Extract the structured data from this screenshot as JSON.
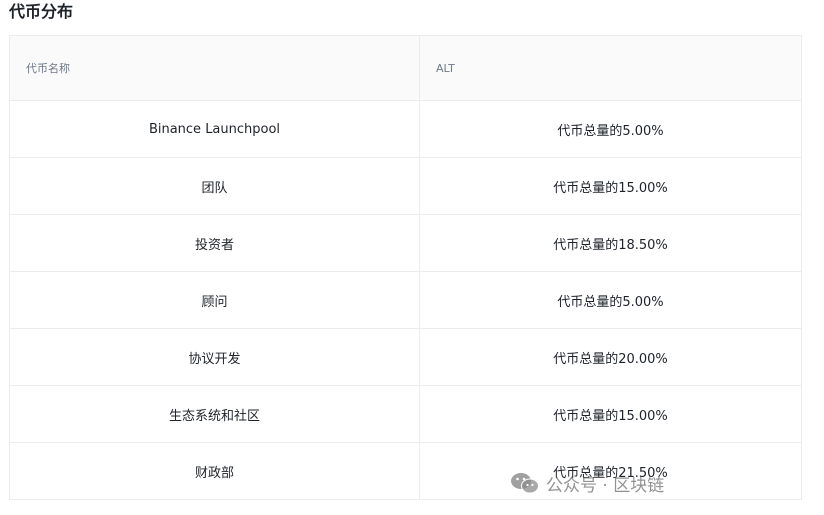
{
  "section": {
    "title": "代币分布"
  },
  "table": {
    "headers": [
      "代币名称",
      "ALT"
    ],
    "rows": [
      {
        "name": "Binance Launchpool",
        "value": "代币总量的5.00%"
      },
      {
        "name": "团队",
        "value": "代币总量的15.00%"
      },
      {
        "name": "投资者",
        "value": "代币总量的18.50%"
      },
      {
        "name": "顾问",
        "value": "代币总量的5.00%"
      },
      {
        "name": "协议开发",
        "value": "代币总量的20.00%"
      },
      {
        "name": "生态系统和社区",
        "value": "代币总量的15.00%"
      },
      {
        "name": "财政部",
        "value": "代币总量的21.50%"
      }
    ]
  },
  "watermark": {
    "icon": "wechat-icon",
    "text": "公众号 · 区块链"
  }
}
